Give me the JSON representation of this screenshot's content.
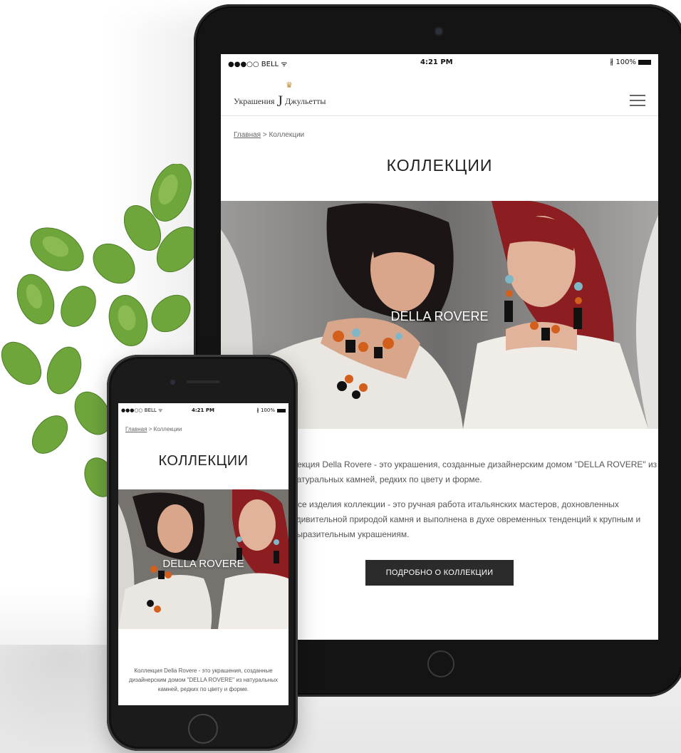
{
  "tablet": {
    "status_bar": {
      "carrier": "●●●○○ BELL ᯤ",
      "time": "4:21 PM",
      "battery": "∦ 100%"
    },
    "header": {
      "logo_left": "Украшения",
      "logo_right": "Джульетты",
      "logo_letter": "J",
      "crown": "♛"
    },
    "breadcrumb": {
      "home": "Главная",
      "separator": " > ",
      "current": "Коллекции"
    },
    "title": "КОЛЛЕКЦИИ",
    "hero_label": "DELLA ROVERE",
    "description": [
      "лекция Della Rovere - это украшения, созданные дизайнерским домом \"DELLA ROVERE\" из натуральных камней, редких по цвету и форме.",
      "Все изделия коллекции - это ручная работа итальянских мастеров, дохновленных удивительной природой камня и выполнена в духе овременных тенденций к крупным и выразительным украшениям."
    ],
    "button_label": "ПОДРОБНО О КОЛЛЕКЦИИ"
  },
  "phone": {
    "status_bar": {
      "carrier": "●●●○○ BELL ᯤ",
      "time": "4:21 PM",
      "battery": "∦ 100%"
    },
    "breadcrumb": {
      "home": "Главная",
      "separator": " > ",
      "current": "Коллекции"
    },
    "title": "КОЛЛЕКЦИИ",
    "hero_label": "DELLA ROVERE",
    "description": "Коллекция Della Rovere - это украшения, созданные  дизайнерским домом \"DELLA ROVERE\" из натуральных камней, редких  по цвету и форме."
  },
  "colors": {
    "device": "#141414",
    "button": "#2b2b2b",
    "accent_crown": "#b88a2c",
    "plant": "#6fa63c"
  }
}
